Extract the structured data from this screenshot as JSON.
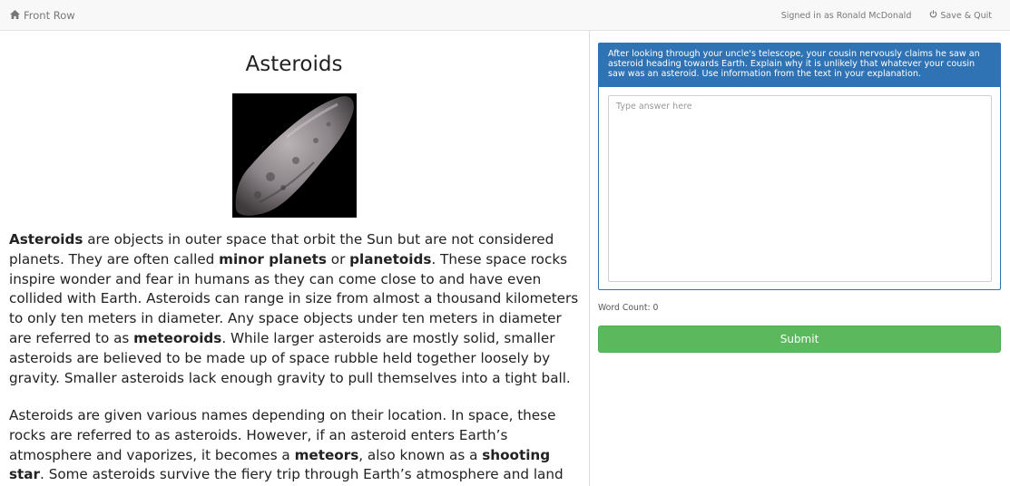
{
  "navbar": {
    "brand_icon": "home-icon",
    "brand_label": "Front Row",
    "signed_in_text": "Signed in as Ronald McDonald",
    "save_quit_icon": "power-icon",
    "save_quit_label": "Save & Quit"
  },
  "article": {
    "title": "Asteroids",
    "image_alt": "asteroid-photo",
    "paragraph1": [
      {
        "text": "Asteroids",
        "bold": true
      },
      {
        "text": " are objects in outer space that orbit the Sun but are not considered planets. They are often called ",
        "bold": false
      },
      {
        "text": "minor planets",
        "bold": true
      },
      {
        "text": " or ",
        "bold": false
      },
      {
        "text": "planetoids",
        "bold": true
      },
      {
        "text": ". These space rocks inspire wonder and fear in humans as they can come close to and have even collided with Earth. Asteroids can range in size from almost a thousand kilometers to only ten meters in diameter. Any space objects under ten meters in diameter are referred to as ",
        "bold": false
      },
      {
        "text": "meteoroids",
        "bold": true
      },
      {
        "text": ". While larger asteroids are mostly solid, smaller asteroids are believed to be made up of space rubble held together loosely by gravity. Smaller asteroids lack enough gravity to pull themselves into a tight ball.",
        "bold": false
      }
    ],
    "paragraph2": [
      {
        "text": "Asteroids are given various names depending on their location. In space, these rocks are referred to as asteroids. However, if an asteroid enters Earth’s atmosphere and vaporizes, it becomes a ",
        "bold": false
      },
      {
        "text": "meteors",
        "bold": true
      },
      {
        "text": ", also known as a ",
        "bold": false
      },
      {
        "text": "shooting star",
        "bold": true
      },
      {
        "text": ". Some asteroids survive the fiery trip through Earth’s atmosphere and land on Earth’s surface. These",
        "bold": false
      }
    ]
  },
  "question": {
    "prompt": "After looking through your uncle's telescope, your cousin nervously claims he saw an asteroid heading towards Earth. Explain why it is unlikely that whatever your cousin saw was an asteroid. Use information from the text in your explanation.",
    "answer_placeholder": "Type answer here",
    "answer_value": "",
    "word_count_label": "Word Count: 0",
    "submit_label": "Submit"
  },
  "colors": {
    "question_header": "#2f73b5",
    "submit": "#5cb85c",
    "navbar_bg": "#f8f8f8"
  }
}
